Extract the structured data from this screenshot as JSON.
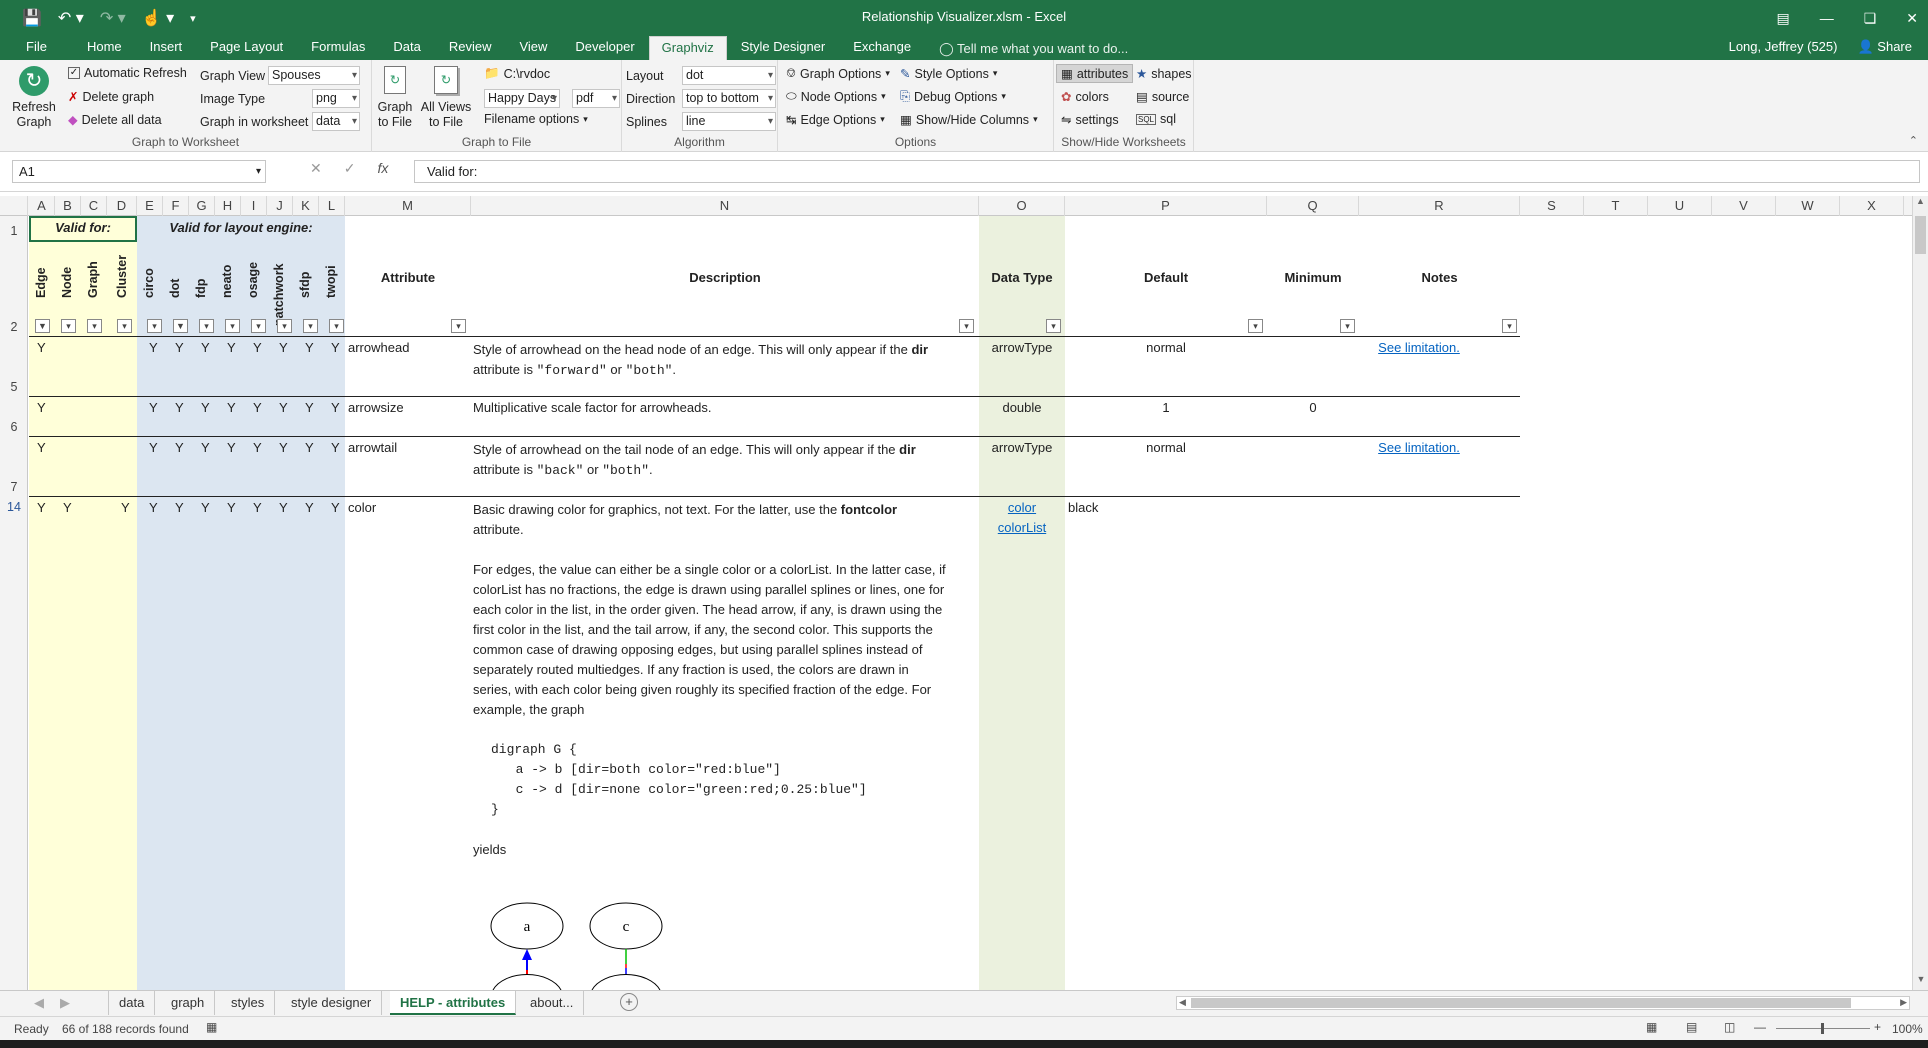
{
  "window": {
    "title": "Relationship Visualizer.xlsm - Excel",
    "user": "Long, Jeffrey (525)",
    "share": "Share"
  },
  "tabs": [
    "File",
    "Home",
    "Insert",
    "Page Layout",
    "Formulas",
    "Data",
    "Review",
    "View",
    "Developer",
    "Graphviz",
    "Style Designer",
    "Exchange"
  ],
  "active_tab": "Graphviz",
  "tellme": "Tell me what you want to do...",
  "ribbon": {
    "refresh": {
      "line1": "Refresh",
      "line2": "Graph"
    },
    "auto_refresh": "Automatic Refresh",
    "delete_graph": "Delete graph",
    "delete_all": "Delete all data",
    "graph_view_label": "Graph View",
    "graph_view_value": "Spouses",
    "image_type_label": "Image Type",
    "image_type_value": "png",
    "graph_in_ws_label": "Graph in worksheet",
    "graph_in_ws_value": "data",
    "group1": "Graph to Worksheet",
    "graph_to_file": {
      "line1": "Graph",
      "line2": "to File"
    },
    "all_views": {
      "line1": "All Views",
      "line2": "to File"
    },
    "folder": "C:\\rvdoc",
    "filename": "Happy Days",
    "ext": "pdf",
    "filename_options": "Filename options",
    "group2": "Graph to File",
    "layout_label": "Layout",
    "layout_value": "dot",
    "direction_label": "Direction",
    "direction_value": "top to bottom",
    "splines_label": "Splines",
    "splines_value": "line",
    "group3": "Algorithm",
    "graph_options": "Graph Options",
    "node_options": "Node Options",
    "edge_options": "Edge Options",
    "style_options": "Style Options",
    "debug_options": "Debug Options",
    "showhide_columns": "Show/Hide Columns",
    "group4": "Options",
    "attributes": "attributes",
    "colors": "colors",
    "settings": "settings",
    "shapes": "shapes",
    "source": "source",
    "sql": "sql",
    "group5": "Show/Hide Worksheets"
  },
  "namebox": "A1",
  "formula": "Valid for:",
  "columns": [
    "A",
    "B",
    "C",
    "D",
    "E",
    "F",
    "G",
    "H",
    "I",
    "J",
    "K",
    "L",
    "M",
    "N",
    "O",
    "P",
    "Q",
    "R",
    "S",
    "T",
    "U",
    "V",
    "W",
    "X"
  ],
  "header": {
    "valid_for": "Valid for:",
    "valid_for_engine": "Valid for layout engine:",
    "vertical": [
      "Edge",
      "Node",
      "Graph",
      "Cluster",
      "circo",
      "dot",
      "fdp",
      "neato",
      "osage",
      "patchwork",
      "sfdp",
      "twopi"
    ],
    "attribute": "Attribute",
    "description": "Description",
    "data_type": "Data Type",
    "default": "Default",
    "minimum": "Minimum",
    "notes": "Notes"
  },
  "rows": [
    {
      "num": "5",
      "flags": [
        "Y",
        "",
        "",
        "",
        "Y",
        "Y",
        "Y",
        "Y",
        "Y",
        "Y",
        "Y",
        "Y"
      ],
      "attribute": "arrowhead",
      "desc_a": "Style of arrowhead on the head node of an edge. This will only appear if the ",
      "desc_bold": "dir",
      "desc_b": " attribute is ",
      "desc_code1": "\"forward\"",
      "desc_or": " or ",
      "desc_code2": "\"both\"",
      "desc_end": ".",
      "data_type": "arrowType",
      "default": "normal",
      "minimum": "",
      "notes": "See limitation."
    },
    {
      "num": "6",
      "flags": [
        "Y",
        "",
        "",
        "",
        "Y",
        "Y",
        "Y",
        "Y",
        "Y",
        "Y",
        "Y",
        "Y"
      ],
      "attribute": "arrowsize",
      "desc": "Multiplicative scale factor for arrowheads.",
      "data_type": "double",
      "default": "1",
      "minimum": "0",
      "notes": ""
    },
    {
      "num": "7",
      "flags": [
        "Y",
        "",
        "",
        "",
        "Y",
        "Y",
        "Y",
        "Y",
        "Y",
        "Y",
        "Y",
        "Y"
      ],
      "attribute": "arrowtail",
      "desc_a": "Style of arrowhead on the tail node of an edge. This will only appear if the ",
      "desc_bold": "dir",
      "desc_b": " attribute is ",
      "desc_code1": "\"back\"",
      "desc_or": " or ",
      "desc_code2": "\"both\"",
      "desc_end": ".",
      "data_type": "arrowType",
      "default": "normal",
      "minimum": "",
      "notes": "See limitation."
    },
    {
      "num": "14",
      "flags": [
        "Y",
        "Y",
        "",
        "Y",
        "Y",
        "Y",
        "Y",
        "Y",
        "Y",
        "Y",
        "Y",
        "Y"
      ],
      "attribute": "color",
      "desc_p1a": "Basic drawing color for graphics, not text. For the latter, use the ",
      "desc_p1b": "fontcolor",
      "desc_p1c": "attribute.",
      "desc_p2": [
        "For edges, the value can either be a single color or a colorList.  In the latter case, if",
        "colorList has no fractions, the edge is drawn using parallel splines or lines, one for",
        "each color in the list, in the order given. The head arrow, if any, is drawn using the",
        "first color in the list, and the tail arrow, if any, the second color. This supports the",
        "common case of drawing opposing edges, but using parallel splines instead of",
        "separately routed multiedges. If any fraction is used, the colors are drawn in",
        "series, with each color being given roughly its specified fraction of the edge. For",
        "example, the graph"
      ],
      "code": [
        "digraph G {",
        "  a -> b [dir=both color=\"red:blue\"]",
        "  c -> d [dir=none color=\"green:red;0.25:blue\"]",
        "}"
      ],
      "yields": "yields",
      "data_type1": "color",
      "data_type2": "colorList",
      "default": "black"
    }
  ],
  "diagram": {
    "node_a": "a",
    "node_c": "c"
  },
  "sheets": [
    "data",
    "graph",
    "styles",
    "style designer",
    "HELP - attributes",
    "about..."
  ],
  "active_sheet": "HELP - attributes",
  "status": {
    "ready": "Ready",
    "records": "66 of 188 records found",
    "zoom": "100%"
  },
  "colors": {
    "excel_green": "#217346",
    "yellow_band": "#ffffd9",
    "blue_band": "#dce6f1",
    "green_band": "#ebf1de"
  }
}
